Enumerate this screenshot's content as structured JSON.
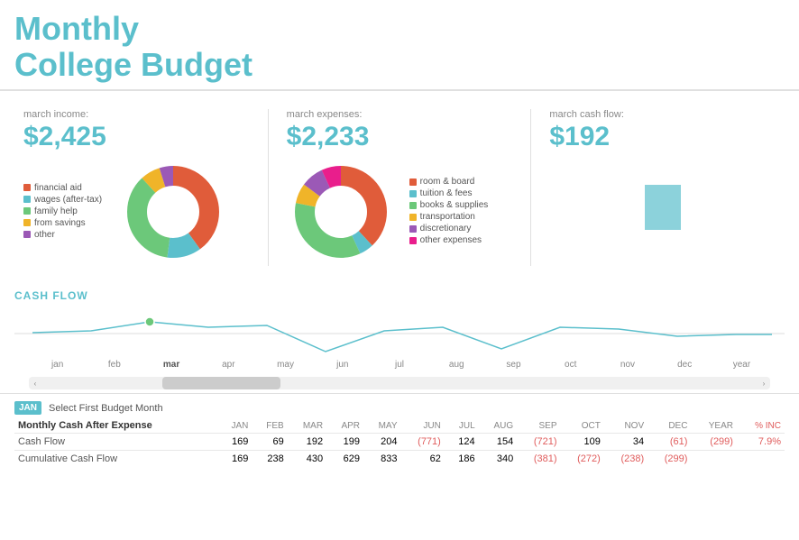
{
  "header": {
    "title_line1": "Monthly",
    "title_line2": "College Budget"
  },
  "income_card": {
    "label": "march income:",
    "amount": "$2,425",
    "legend": [
      {
        "color": "#e05c3a",
        "text": "financial aid"
      },
      {
        "color": "#5bbfcc",
        "text": "wages (after-tax)"
      },
      {
        "color": "#6cc87a",
        "text": "family help"
      },
      {
        "color": "#f0b429",
        "text": "from savings"
      },
      {
        "color": "#9b59b6",
        "text": "other"
      }
    ],
    "donut": {
      "segments": [
        {
          "color": "#e05c3a",
          "pct": 40
        },
        {
          "color": "#5bbfcc",
          "pct": 12
        },
        {
          "color": "#6cc87a",
          "pct": 36
        },
        {
          "color": "#f0b429",
          "pct": 7
        },
        {
          "color": "#9b59b6",
          "pct": 5
        }
      ]
    }
  },
  "expenses_card": {
    "label": "march expenses:",
    "amount": "$2,233",
    "legend": [
      {
        "color": "#e05c3a",
        "text": "room & board"
      },
      {
        "color": "#5bbfcc",
        "text": "tuition & fees"
      },
      {
        "color": "#6cc87a",
        "text": "books & supplies"
      },
      {
        "color": "#f0b429",
        "text": "transportation"
      },
      {
        "color": "#9b59b6",
        "text": "discretionary"
      },
      {
        "color": "#e91e8c",
        "text": "other expenses"
      }
    ],
    "donut": {
      "segments": [
        {
          "color": "#e05c3a",
          "pct": 38
        },
        {
          "color": "#5bbfcc",
          "pct": 5
        },
        {
          "color": "#6cc87a",
          "pct": 35
        },
        {
          "color": "#f0b429",
          "pct": 7
        },
        {
          "color": "#9b59b6",
          "pct": 8
        },
        {
          "color": "#e91e8c",
          "pct": 7
        }
      ]
    }
  },
  "cashflow_card": {
    "label": "march cash flow:",
    "amount": "$192"
  },
  "cashflow_section": {
    "title": "CASH FLOW",
    "months": [
      "jan",
      "feb",
      "mar",
      "apr",
      "may",
      "jun",
      "jul",
      "aug",
      "sep",
      "oct",
      "nov",
      "dec",
      "year"
    ],
    "active_month": "mar"
  },
  "scrollbar": {
    "left_arrow": "‹",
    "right_arrow": "›"
  },
  "table": {
    "jan_badge": "JAN",
    "select_label": "Select First Budget Month",
    "mar_col_label": "MAR",
    "pct_col_label": "% INC",
    "columns": [
      "",
      "JAN",
      "FEB",
      "MAR",
      "APR",
      "MAY",
      "JUN",
      "JUL",
      "AUG",
      "SEP",
      "OCT",
      "NOV",
      "DEC",
      "YEAR",
      "% INC"
    ],
    "rows": [
      {
        "label": "Cash Flow",
        "values": [
          "169",
          "69",
          "192",
          "199",
          "204",
          "(771)",
          "124",
          "154",
          "(721)",
          "109",
          "34",
          "(61)",
          "(299)",
          "7.9%"
        ],
        "negative_indices": [
          5,
          8,
          11,
          12
        ]
      },
      {
        "label": "Cumulative Cash Flow",
        "values": [
          "169",
          "238",
          "430",
          "629",
          "833",
          "62",
          "186",
          "340",
          "(381)",
          "(272)",
          "(238)",
          "(299)",
          "",
          ""
        ],
        "negative_indices": [
          8,
          9,
          10,
          11
        ]
      }
    ]
  }
}
